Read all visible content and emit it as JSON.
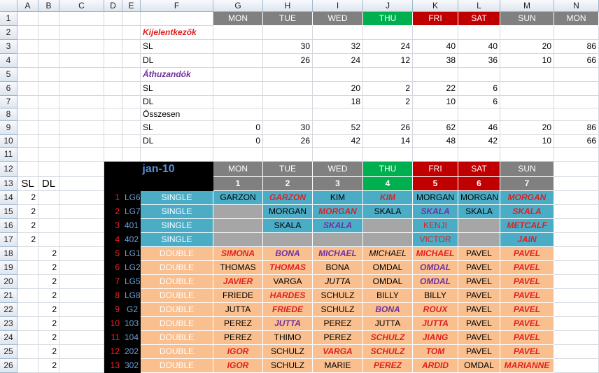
{
  "columns": [
    "A",
    "B",
    "C",
    "D",
    "E",
    "F",
    "G",
    "H",
    "I",
    "J",
    "K",
    "L",
    "M",
    "N"
  ],
  "rows": [
    "1",
    "2",
    "3",
    "4",
    "5",
    "6",
    "7",
    "8",
    "9",
    "10",
    "11",
    "12",
    "13",
    "14",
    "15",
    "16",
    "17",
    "18",
    "19",
    "20",
    "21",
    "22",
    "23",
    "24",
    "25",
    "26"
  ],
  "colors": {
    "grey": "#808080",
    "green": "#00b050",
    "red": "#c00000",
    "blue": "#4bacc6",
    "orange": "#fabf8f",
    "black": "#000000",
    "name_red": "#e02020",
    "name_purple": "#7030a0"
  },
  "top": {
    "days": [
      "MON",
      "TUE",
      "WED",
      "THU",
      "FRI",
      "SAT",
      "SUN",
      "MON"
    ],
    "day_colors": [
      "grey",
      "grey",
      "grey",
      "green",
      "red",
      "red",
      "grey",
      "grey"
    ],
    "section1": "Kijelentkezők",
    "section2": "Áthuzandók",
    "section3": "Összesen",
    "sl_label": "SL",
    "dl_label": "DL",
    "kij_sl": [
      "",
      "30",
      "32",
      "24",
      "40",
      "40",
      "20",
      "86"
    ],
    "kij_dl": [
      "",
      "26",
      "24",
      "12",
      "38",
      "36",
      "10",
      "66"
    ],
    "ath_sl": [
      "",
      "",
      "20",
      "2",
      "22",
      "6",
      "",
      ""
    ],
    "ath_dl": [
      "",
      "",
      "18",
      "2",
      "10",
      "6",
      "",
      ""
    ],
    "tot_sl": [
      "0",
      "30",
      "52",
      "26",
      "62",
      "46",
      "20",
      "86"
    ],
    "tot_dl": [
      "0",
      "26",
      "42",
      "14",
      "48",
      "42",
      "10",
      "66"
    ]
  },
  "schedule": {
    "month": "jan-10",
    "days": [
      "MON",
      "TUE",
      "WED",
      "THU",
      "FRI",
      "SAT",
      "SUN"
    ],
    "day_colors": [
      "grey",
      "grey",
      "grey",
      "green",
      "red",
      "red",
      "grey"
    ],
    "dates": [
      "1",
      "2",
      "3",
      "4",
      "5",
      "6",
      "7"
    ],
    "date_colors": [
      "grey",
      "grey",
      "grey",
      "green",
      "red",
      "red",
      "grey"
    ],
    "sl_header": "SL",
    "dl_header": "DL",
    "rooms": [
      {
        "sl": "2",
        "dl": "",
        "num": "1",
        "room": "LG6",
        "type": "SINGLE",
        "cells": [
          {
            "t": "GARZON",
            "s": "n"
          },
          {
            "t": "GARZON",
            "s": "r"
          },
          {
            "t": "KIM",
            "s": "n"
          },
          {
            "t": "KIM",
            "s": "r"
          },
          {
            "t": "MORGAN",
            "s": "n"
          },
          {
            "t": "MORGAN",
            "s": "n"
          },
          {
            "t": "MORGAN",
            "s": "r"
          }
        ],
        "blank": []
      },
      {
        "sl": "2",
        "dl": "",
        "num": "2",
        "room": "LG7",
        "type": "SINGLE",
        "cells": [
          {
            "t": "",
            "s": "n"
          },
          {
            "t": "MORGAN",
            "s": "n"
          },
          {
            "t": "MORGAN",
            "s": "r"
          },
          {
            "t": "SKALA",
            "s": "n"
          },
          {
            "t": "SKALA",
            "s": "p"
          },
          {
            "t": "SKALA",
            "s": "n"
          },
          {
            "t": "SKALA",
            "s": "r"
          }
        ],
        "blank": [
          0
        ]
      },
      {
        "sl": "2",
        "dl": "",
        "num": "3",
        "room": "401",
        "type": "SINGLE",
        "cells": [
          {
            "t": "",
            "s": "n"
          },
          {
            "t": "SKALA",
            "s": "n"
          },
          {
            "t": "SKALA",
            "s": "p"
          },
          {
            "t": "",
            "s": "n"
          },
          {
            "t": "KENJI",
            "s": "rn"
          },
          {
            "t": "",
            "s": "n"
          },
          {
            "t": "METCALF",
            "s": "r"
          }
        ],
        "blank": [
          0,
          3,
          5
        ]
      },
      {
        "sl": "2",
        "dl": "",
        "num": "4",
        "room": "402",
        "type": "SINGLE",
        "cells": [
          {
            "t": "",
            "s": "n"
          },
          {
            "t": "",
            "s": "n"
          },
          {
            "t": "",
            "s": "n"
          },
          {
            "t": "",
            "s": "n"
          },
          {
            "t": "VICTOR",
            "s": "rn"
          },
          {
            "t": "",
            "s": "n"
          },
          {
            "t": "JAIN",
            "s": "r"
          }
        ],
        "blank": [
          0,
          1,
          2,
          3,
          5
        ]
      },
      {
        "sl": "",
        "dl": "2",
        "num": "5",
        "room": "LG1",
        "type": "DOUBLE",
        "cells": [
          {
            "t": "SIMONA",
            "s": "r"
          },
          {
            "t": "BONA",
            "s": "p"
          },
          {
            "t": "MICHAEL",
            "s": "p"
          },
          {
            "t": "MICHAEL",
            "s": "i"
          },
          {
            "t": "MICHAEL",
            "s": "r"
          },
          {
            "t": "PAVEL",
            "s": "n"
          },
          {
            "t": "PAVEL",
            "s": "r"
          }
        ],
        "blank": []
      },
      {
        "sl": "",
        "dl": "2",
        "num": "6",
        "room": "LG2",
        "type": "DOUBLE",
        "cells": [
          {
            "t": "THOMAS",
            "s": "n"
          },
          {
            "t": "THOMAS",
            "s": "r"
          },
          {
            "t": "BONA",
            "s": "n"
          },
          {
            "t": "OMDAL",
            "s": "n"
          },
          {
            "t": "OMDAL",
            "s": "p"
          },
          {
            "t": "PAVEL",
            "s": "n"
          },
          {
            "t": "PAVEL",
            "s": "r"
          }
        ],
        "blank": []
      },
      {
        "sl": "",
        "dl": "2",
        "num": "7",
        "room": "LG5",
        "type": "DOUBLE",
        "cells": [
          {
            "t": "JAVIER",
            "s": "r"
          },
          {
            "t": "VARGA",
            "s": "n"
          },
          {
            "t": "JUTTA",
            "s": "i"
          },
          {
            "t": "OMDAL",
            "s": "n"
          },
          {
            "t": "OMDAL",
            "s": "p"
          },
          {
            "t": "PAVEL",
            "s": "n"
          },
          {
            "t": "PAVEL",
            "s": "r"
          }
        ],
        "blank": []
      },
      {
        "sl": "",
        "dl": "2",
        "num": "8",
        "room": "LG8",
        "type": "DOUBLE",
        "cells": [
          {
            "t": "FRIEDE",
            "s": "n"
          },
          {
            "t": "HARDES",
            "s": "r"
          },
          {
            "t": "SCHULZ",
            "s": "n"
          },
          {
            "t": "BILLY",
            "s": "n"
          },
          {
            "t": "BILLY",
            "s": "n"
          },
          {
            "t": "PAVEL",
            "s": "n"
          },
          {
            "t": "PAVEL",
            "s": "r"
          }
        ],
        "blank": []
      },
      {
        "sl": "",
        "dl": "2",
        "num": "9",
        "room": "G2",
        "type": "DOUBLE",
        "cells": [
          {
            "t": "JUTTA",
            "s": "n"
          },
          {
            "t": "FRIEDE",
            "s": "r"
          },
          {
            "t": "SCHULZ",
            "s": "n"
          },
          {
            "t": "BONA",
            "s": "p"
          },
          {
            "t": "ROUX",
            "s": "r"
          },
          {
            "t": "PAVEL",
            "s": "n"
          },
          {
            "t": "PAVEL",
            "s": "r"
          }
        ],
        "blank": []
      },
      {
        "sl": "",
        "dl": "2",
        "num": "10",
        "room": "103",
        "type": "DOUBLE",
        "cells": [
          {
            "t": "PEREZ",
            "s": "n"
          },
          {
            "t": "JUTTA",
            "s": "p"
          },
          {
            "t": "PEREZ",
            "s": "n"
          },
          {
            "t": "JUTTA",
            "s": "n"
          },
          {
            "t": "JUTTA",
            "s": "r"
          },
          {
            "t": "PAVEL",
            "s": "n"
          },
          {
            "t": "PAVEL",
            "s": "r"
          }
        ],
        "blank": []
      },
      {
        "sl": "",
        "dl": "2",
        "num": "11",
        "room": "104",
        "type": "DOUBLE",
        "cells": [
          {
            "t": "PEREZ",
            "s": "n"
          },
          {
            "t": "THIMO",
            "s": "n"
          },
          {
            "t": "PEREZ",
            "s": "n"
          },
          {
            "t": "SCHULZ",
            "s": "r"
          },
          {
            "t": "JIANG",
            "s": "r"
          },
          {
            "t": "PAVEL",
            "s": "n"
          },
          {
            "t": "PAVEL",
            "s": "r"
          }
        ],
        "blank": []
      },
      {
        "sl": "",
        "dl": "2",
        "num": "12",
        "room": "202",
        "type": "DOUBLE",
        "cells": [
          {
            "t": "IGOR",
            "s": "r"
          },
          {
            "t": "SCHULZ",
            "s": "n"
          },
          {
            "t": "VARGA",
            "s": "r"
          },
          {
            "t": "SCHULZ",
            "s": "r"
          },
          {
            "t": "TOM",
            "s": "r"
          },
          {
            "t": "PAVEL",
            "s": "n"
          },
          {
            "t": "PAVEL",
            "s": "r"
          }
        ],
        "blank": []
      },
      {
        "sl": "",
        "dl": "2",
        "num": "13",
        "room": "302",
        "type": "DOUBLE",
        "cells": [
          {
            "t": "IGOR",
            "s": "r"
          },
          {
            "t": "SCHULZ",
            "s": "n"
          },
          {
            "t": "MARIE",
            "s": "n"
          },
          {
            "t": "PEREZ",
            "s": "r"
          },
          {
            "t": "ARDID",
            "s": "r"
          },
          {
            "t": "OMDAL",
            "s": "n"
          },
          {
            "t": "MARIANNE",
            "s": "r"
          }
        ],
        "blank": []
      }
    ]
  }
}
